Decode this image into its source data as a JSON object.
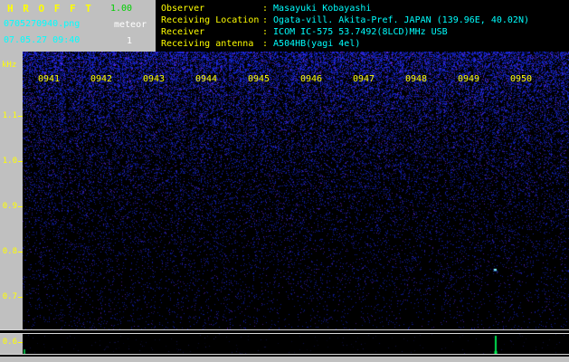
{
  "titlebar": {
    "app_title": "H R O F F T",
    "version": "1.00",
    "filename": "0705270940.png",
    "mode_label": "meteor",
    "datetime": "07.05.27 09:40",
    "count": "1"
  },
  "info": {
    "separator": ":",
    "rows": [
      {
        "label": "Observer",
        "value": "Masayuki Kobayashi"
      },
      {
        "label": "Receiving Location",
        "value": "Ogata-vill. Akita-Pref. JAPAN (139.96E, 40.02N)"
      },
      {
        "label": "Receiver",
        "value": "ICOM IC-575 53.7492(8LCD)MHz USB"
      },
      {
        "label": "Receiving antenna",
        "value": "A504HB(yagi 4el)"
      }
    ]
  },
  "chart_data": {
    "type": "heatmap",
    "title": "HROFFT 10-minute radio meteor spectrogram 09:40-09:50",
    "ylabel": "kHz",
    "y_ticks": [
      "1.1",
      "1.0",
      "0.9",
      "0.8",
      "0.7",
      "0.6"
    ],
    "ylim": [
      0.55,
      1.25
    ],
    "x_ticks": [
      "0941",
      "0942",
      "0943",
      "0944",
      "0945",
      "0946",
      "0947",
      "0948",
      "0949",
      "0950"
    ],
    "background": "blue broadband noise, densest above 1.1 kHz, fading toward 0.6 kHz",
    "echoes": [
      {
        "time": "0949.5",
        "freq_khz": 0.76,
        "x_frac": 0.865,
        "note": "faint meteor echo"
      }
    ],
    "level_strip": {
      "description": "signal level vs time, flat baseline",
      "spikes": [
        {
          "time": "0949.5",
          "x_frac": 0.865,
          "height_frac": 0.9,
          "color": "#00e050"
        }
      ]
    },
    "colors": {
      "axis_text": "#ffff00",
      "noise": "#2020c0",
      "panel_bg": "#000000"
    }
  }
}
